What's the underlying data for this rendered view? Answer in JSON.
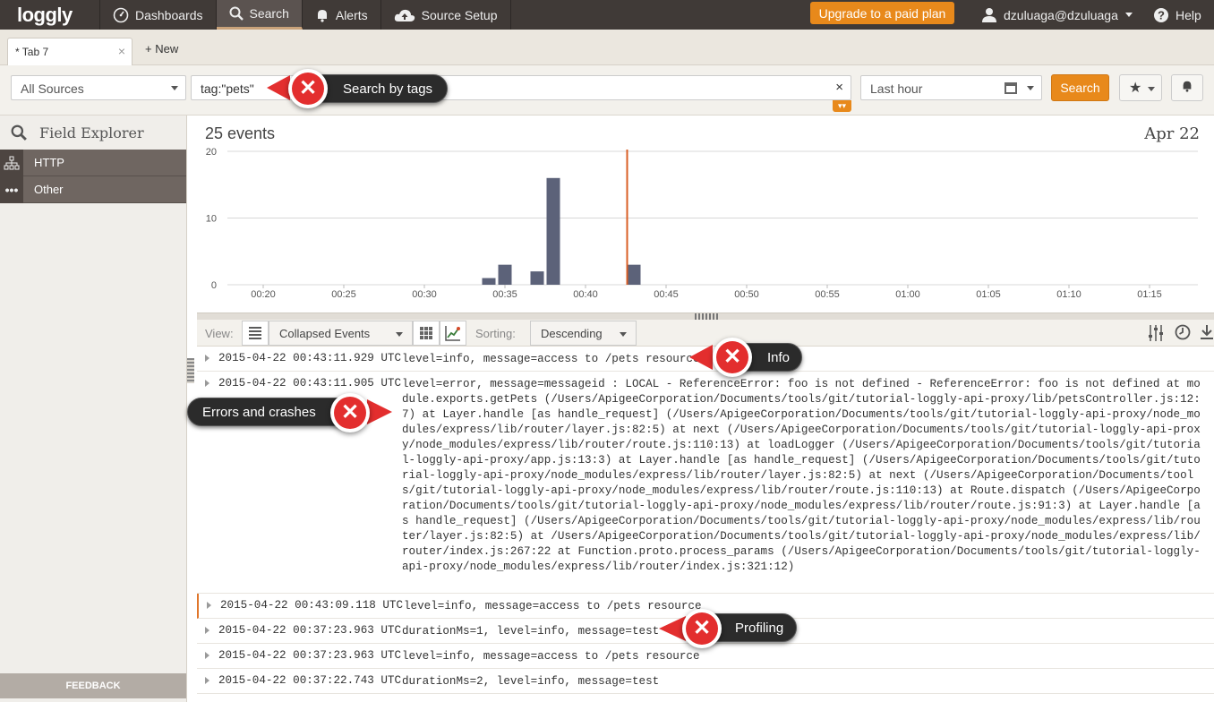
{
  "nav": {
    "logo": "loggly",
    "items": [
      {
        "label": "Dashboards",
        "icon": "dashboard-icon"
      },
      {
        "label": "Search",
        "icon": "search-icon"
      },
      {
        "label": "Alerts",
        "icon": "bell-icon"
      },
      {
        "label": "Source Setup",
        "icon": "cloud-upload-icon"
      }
    ],
    "upgrade": "Upgrade to a paid plan",
    "user": "dzuluaga@dzuluaga",
    "help": "Help"
  },
  "tabs": {
    "current": "* Tab 7",
    "close": "×",
    "new": "+ New"
  },
  "search": {
    "source": "All Sources",
    "query": "tag:\"pets\"",
    "clear": "×",
    "timerange": "Last hour",
    "button": "Search"
  },
  "sidebar": {
    "title": "Field Explorer",
    "items": [
      {
        "label": "HTTP",
        "icon": "network-icon"
      },
      {
        "label": "Other",
        "icon": "ellipsis-icon"
      }
    ],
    "feedback": "FEEDBACK"
  },
  "chart_data": {
    "type": "bar",
    "title": "25 events",
    "date": "Apr 22",
    "ylim": [
      0,
      20
    ],
    "yticks": [
      "20",
      "10",
      "0"
    ],
    "xticks": [
      "00:20",
      "00:25",
      "00:30",
      "00:35",
      "00:40",
      "00:45",
      "00:50",
      "00:55",
      "01:00",
      "01:05",
      "01:10",
      "01:15"
    ],
    "bars": [
      {
        "time": "00:34",
        "value": 1
      },
      {
        "time": "00:35",
        "value": 3
      },
      {
        "time": "00:37",
        "value": 2
      },
      {
        "time": "00:38",
        "value": 16
      },
      {
        "time": "00:43",
        "value": 3
      }
    ],
    "marker": "00:43",
    "colors": {
      "bar": "#5c6279",
      "marker": "#d95f26",
      "grid": "#d8d8d8"
    }
  },
  "view": {
    "label": "View:",
    "mode": "Collapsed Events",
    "sorting_label": "Sorting:",
    "sorting": "Descending"
  },
  "events": [
    {
      "ts": "2015-04-22 00:43:11.929 UTC",
      "msg": "level=info, message=access to /pets resource"
    },
    {
      "ts": "2015-04-22 00:43:11.905 UTC",
      "msg": "level=error, message=messageid : LOCAL - ReferenceError: foo is not defined - ReferenceError: foo is not defined at module.exports.getPets (/Users/ApigeeCorporation/Documents/tools/git/tutorial-loggly-api-proxy/lib/petsController.js:12:7) at Layer.handle [as handle_request] (/Users/ApigeeCorporation/Documents/tools/git/tutorial-loggly-api-proxy/node_modules/express/lib/router/layer.js:82:5) at next (/Users/ApigeeCorporation/Documents/tools/git/tutorial-loggly-api-proxy/node_modules/express/lib/router/route.js:110:13) at loadLogger (/Users/ApigeeCorporation/Documents/tools/git/tutorial-loggly-api-proxy/app.js:13:3) at Layer.handle [as handle_request] (/Users/ApigeeCorporation/Documents/tools/git/tutorial-loggly-api-proxy/node_modules/express/lib/router/layer.js:82:5) at next (/Users/ApigeeCorporation/Documents/tools/git/tutorial-loggly-api-proxy/node_modules/express/lib/router/route.js:110:13) at Route.dispatch (/Users/ApigeeCorporation/Documents/tools/git/tutorial-loggly-api-proxy/node_modules/express/lib/router/route.js:91:3) at Layer.handle [as handle_request] (/Users/ApigeeCorporation/Documents/tools/git/tutorial-loggly-api-proxy/node_modules/express/lib/router/layer.js:82:5) at /Users/ApigeeCorporation/Documents/tools/git/tutorial-loggly-api-proxy/node_modules/express/lib/router/index.js:267:22 at Function.proto.process_params (/Users/ApigeeCorporation/Documents/tools/git/tutorial-loggly-api-proxy/node_modules/express/lib/router/index.js:321:12)"
    },
    {
      "ts": "2015-04-22 00:43:09.118 UTC",
      "msg": "level=info, message=access to /pets resource"
    },
    {
      "ts": "2015-04-22 00:37:23.963 UTC",
      "msg": "durationMs=1, level=info, message=test"
    },
    {
      "ts": "2015-04-22 00:37:23.963 UTC",
      "msg": "level=info, message=access to /pets resource"
    },
    {
      "ts": "2015-04-22 00:37:22.743 UTC",
      "msg": "durationMs=2, level=info, message=test"
    }
  ],
  "callouts": {
    "search": "Search by tags",
    "info": "Info",
    "errors": "Errors and crashes",
    "profiling": "Profiling"
  }
}
